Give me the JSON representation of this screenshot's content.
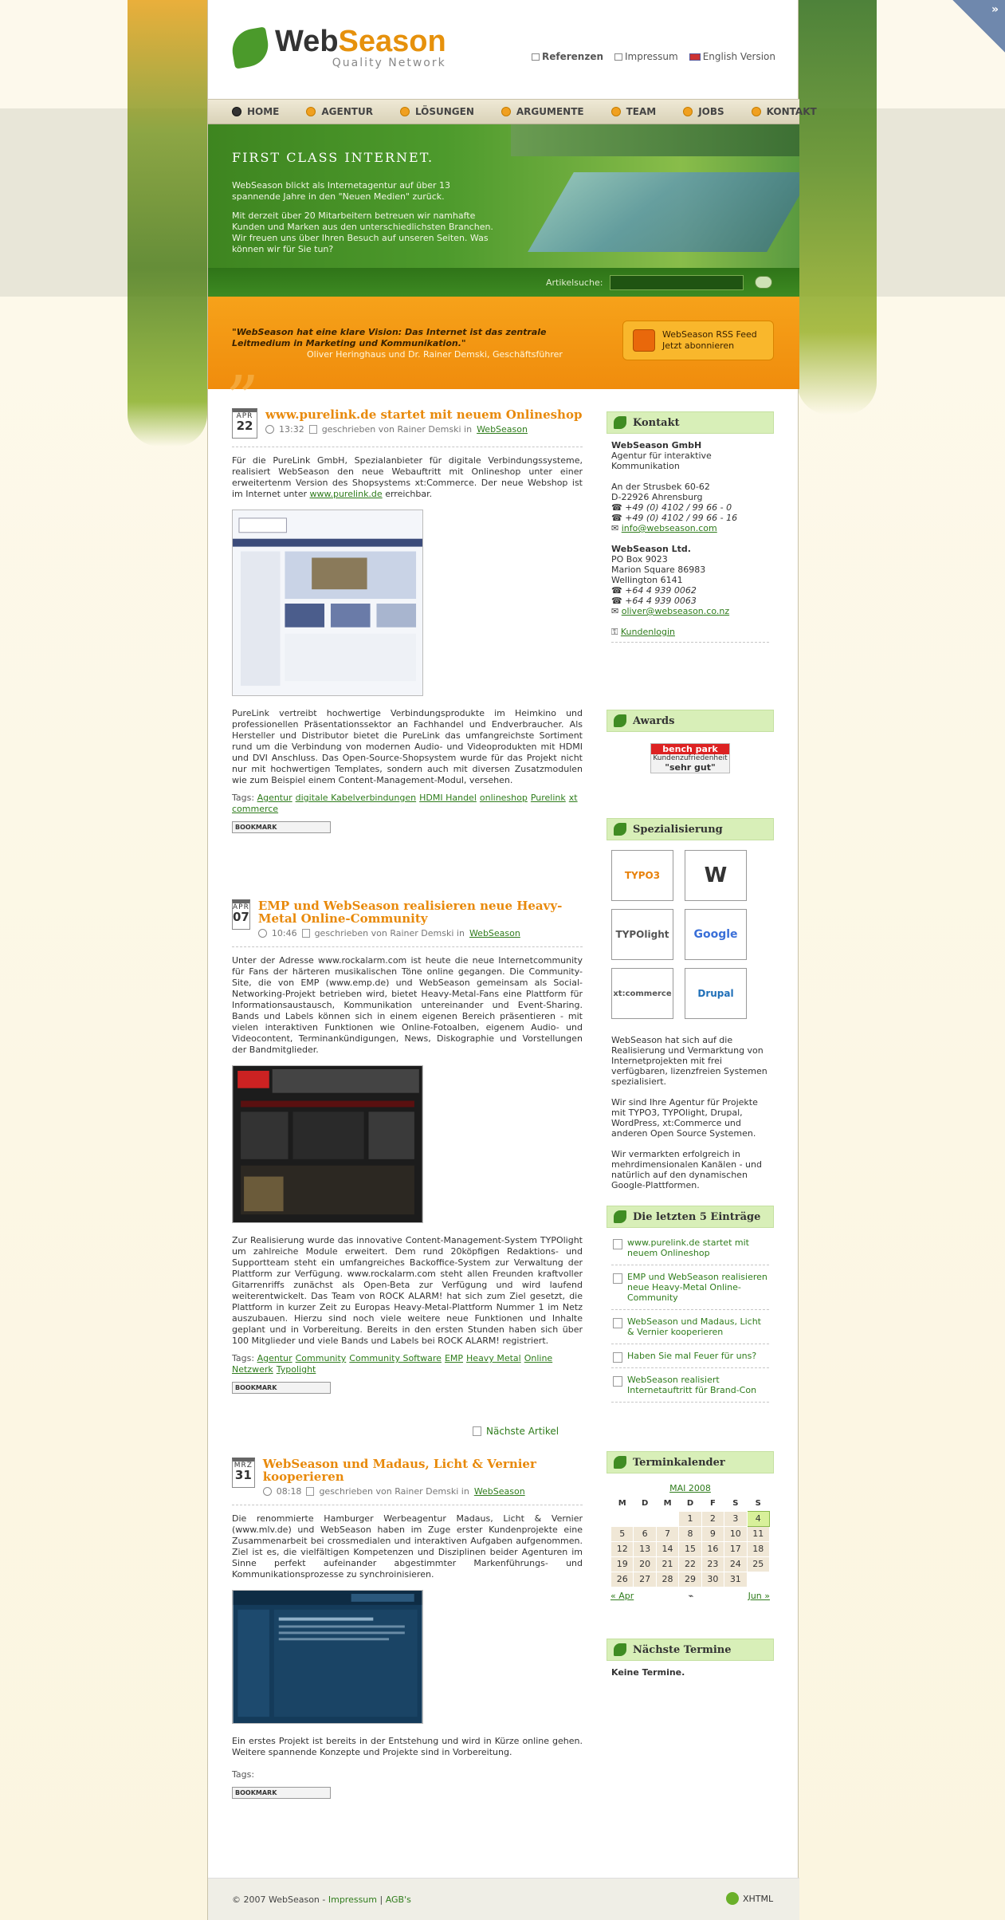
{
  "logo": {
    "web": "Web",
    "season": "Season",
    "tagline": "Quality Network"
  },
  "toplinks": [
    "Referenzen",
    "Impressum",
    "English Version"
  ],
  "nav": [
    "HOME",
    "AGENTUR",
    "LÖSUNGEN",
    "ARGUMENTE",
    "TEAM",
    "JOBS",
    "KONTAKT"
  ],
  "hero": {
    "title": "FIRST CLASS INTERNET.",
    "p1": "WebSeason blickt als Internetagentur auf über 13 spannende Jahre in den \"Neuen Medien\" zurück.",
    "p2": "Mit derzeit über 20 Mitarbeitern betreuen wir namhafte Kunden und Marken aus den unterschiedlichsten Branchen. Wir freuen uns über Ihren Besuch auf unseren Seiten. Was können wir für Sie tun?"
  },
  "search": {
    "label": "Artikelsuche:"
  },
  "quote": {
    "text": "\"WebSeason hat eine klare Vision: Das Internet ist das zentrale Leitmedium in Marketing und Kommunikation.\"",
    "author": "Oliver Heringhaus und Dr. Rainer Demski, Geschäftsführer"
  },
  "rss": {
    "l1": "WebSeason RSS Feed",
    "l2": "Jetzt abonnieren"
  },
  "articles": [
    {
      "month": "APR",
      "day": "22",
      "title": "www.purelink.de startet mit neuem Onlineshop",
      "time": "13:32",
      "by": "geschrieben von Rainer Demski in",
      "cat": "WebSeason",
      "p1": "Für die PureLink GmbH, Spezialanbieter für digitale Verbindungssysteme, realisiert WebSeason den neue Webauftritt mit Onlineshop unter einer erweitertenm Version des Shopsystems xt:Commerce. Der neue Webshop ist im Internet unter",
      "link": "www.purelink.de",
      "p1b": "erreichbar.",
      "p2": "PureLink vertreibt hochwertige Verbindungsprodukte im Heimkino und professionellen Präsentationssektor an Fachhandel und Endverbraucher. Als Hersteller und Distributor bietet die PureLink das umfangreichste Sortiment rund um die Verbindung von modernen Audio- und Videoprodukten mit HDMI und DVI Anschluss. Das Open-Source-Shopsystem wurde für das Projekt nicht nur mit hochwertigen Templates, sondern auch mit diversen Zusatzmodulen wie zum Beispiel einem Content-Management-Modul, versehen.",
      "tags": [
        "Agentur",
        "digitale Kabelverbindungen",
        "HDMI Handel",
        "onlineshop",
        "Purelink",
        "xt commerce"
      ]
    },
    {
      "month": "APR",
      "day": "07",
      "title": "EMP und WebSeason realisieren neue Heavy-Metal Online-Community",
      "time": "10:46",
      "by": "geschrieben von Rainer Demski in",
      "cat": "WebSeason",
      "p1": "Unter der Adresse www.rockalarm.com ist heute die neue Internetcommunity für Fans der härteren musikalischen Töne online gegangen. Die Community-Site, die von EMP (www.emp.de) und WebSeason gemeinsam als Social-Networking-Projekt betrieben wird, bietet Heavy-Metal-Fans eine Plattform für Informationsaustausch, Kommunikation untereinander und Event-Sharing. Bands und Labels können sich in einem eigenen Bereich präsentieren - mit vielen interaktiven Funktionen wie Online-Fotoalben, eigenem Audio- und Videocontent, Terminankündigungen, News, Diskographie und Vorstellungen der Bandmitglieder.",
      "p2": "Zur Realisierung wurde das innovative Content-Management-System TYPOlight um zahlreiche Module erweitert. Dem rund 20köpfigen Redaktions- und Supportteam steht ein umfangreiches Backoffice-System zur Verwaltung der Plattform zur Verfügung. www.rockalarm.com steht allen Freunden kraftvoller Gitarrenriffs zunächst als Open-Beta zur Verfügung und wird laufend weiterentwickelt. Das Team von ROCK ALARM! hat sich zum Ziel gesetzt, die Plattform in kurzer Zeit zu Europas Heavy-Metal-Plattform Nummer 1 im Netz auszubauen. Hierzu sind noch viele weitere neue Funktionen und Inhalte geplant und in Vorbereitung. Bereits in den ersten Stunden haben sich über 100 Mitglieder und viele Bands und Labels bei ROCK ALARM! registriert.",
      "tags": [
        "Agentur",
        "Community",
        "Community Software",
        "EMP",
        "Heavy Metal",
        "Online Netzwerk",
        "Typolight"
      ]
    },
    {
      "month": "MRZ",
      "day": "31",
      "title": "WebSeason und Madaus, Licht & Vernier kooperieren",
      "time": "08:18",
      "by": "geschrieben von Rainer Demski in",
      "cat": "WebSeason",
      "p1": "Die renommierte Hamburger Werbeagentur Madaus, Licht & Vernier (www.mlv.de) und WebSeason haben im Zuge erster Kundenprojekte eine Zusammenarbeit bei crossmedialen und interaktiven Aufgaben aufgenommen. Ziel ist es, die vielfältigen Kompetenzen und Disziplinen beider Agenturen im Sinne perfekt aufeinander abgestimmter Markenführungs- und Kommunikationsprozesse zu synchroinisieren.",
      "p2": "Ein erstes Projekt ist bereits in der Entstehung und wird in Kürze online gehen. Weitere spannende Konzepte und Projekte sind in Vorbereitung.",
      "tags": []
    }
  ],
  "tags_label": "Tags:",
  "bookmark": "BOOKMARK",
  "next": "Nächste Artikel",
  "sidebar": {
    "kontakt": {
      "title": "Kontakt",
      "name1": "WebSeason GmbH",
      "l1": "Agentur für interaktive Kommunikation",
      "a1": "An der Strusbek 60-62",
      "a2": "D-22926 Ahrensburg",
      "tel1": "+49 (0) 4102 / 99 66 - 0",
      "fax1": "+49 (0) 4102 / 99 66 - 16",
      "mail1": "info@webseason.com",
      "name2": "WebSeason Ltd.",
      "b1": "PO Box 9023",
      "b2": "Marion Square 86983",
      "b3": "Wellington 6141",
      "tel2": "+64 4 939 0062",
      "fax2": "+64 4 939 0063",
      "mail2": "oliver@webseason.co.nz",
      "login": "Kundenlogin"
    },
    "awards": {
      "title": "Awards",
      "badge1": "bench park",
      "badge2": "Kundenzufriedenheit",
      "badge3": "\"sehr gut\""
    },
    "spec": {
      "title": "Spezialisierung",
      "logos": [
        "TYPO3",
        "W",
        "TYPOlight",
        "Google",
        "xt:commerce",
        "Drupal"
      ],
      "t1": "WebSeason hat sich auf die Realisierung und Vermarktung von Internetprojekten mit frei verfügbaren, lizenzfreien Systemen spezialisiert.",
      "t2": "Wir sind Ihre Agentur für Projekte mit TYPO3, TYPOlight, Drupal, WordPress, xt:Commerce und anderen Open Source Systemen.",
      "t3": "Wir vermarkten erfolgreich in mehrdimensionalen Kanälen - und natürlich auf den dynamischen Google-Plattformen."
    },
    "latest": {
      "title": "Die letzten 5 Einträge",
      "items": [
        "www.purelink.de startet mit neuem Onlineshop",
        "EMP und WebSeason realisieren neue Heavy-Metal Online-Community",
        "WebSeason und Madaus, Licht & Vernier kooperieren",
        "Haben Sie mal Feuer für uns?",
        "WebSeason realisiert Internetauftritt für Brand-Con"
      ]
    },
    "cal": {
      "title": "Terminkalender",
      "month": "MAI 2008",
      "days": [
        "M",
        "D",
        "M",
        "D",
        "F",
        "S",
        "S"
      ],
      "weeks": [
        [
          "",
          "",
          "",
          "1",
          "2",
          "3",
          "4"
        ],
        [
          "5",
          "6",
          "7",
          "8",
          "9",
          "10",
          "11"
        ],
        [
          "12",
          "13",
          "14",
          "15",
          "16",
          "17",
          "18"
        ],
        [
          "19",
          "20",
          "21",
          "22",
          "23",
          "24",
          "25"
        ],
        [
          "26",
          "27",
          "28",
          "29",
          "30",
          "31",
          ""
        ]
      ],
      "today": "4",
      "prev": "« Apr",
      "next": "Jun »"
    },
    "termine": {
      "title": "Nächste Termine",
      "text": "Keine Termine."
    }
  },
  "footer": {
    "copy": "© 2007 WebSeason -",
    "impressum": "Impressum",
    "agb": "AGB's",
    "xhtml": "XHTML"
  }
}
